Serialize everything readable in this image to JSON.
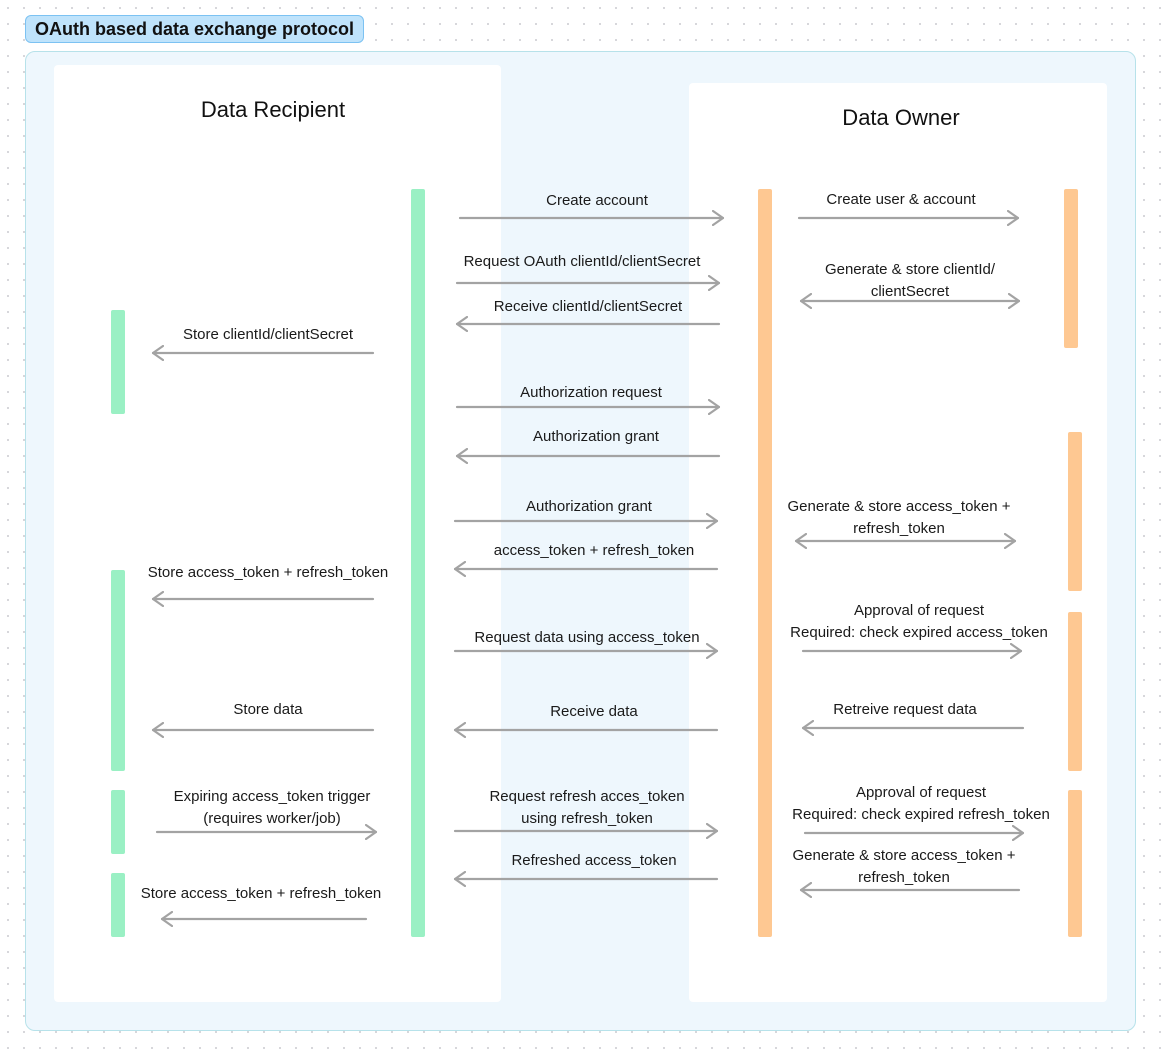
{
  "title": "OAuth based data exchange protocol",
  "lanes": {
    "recipient": "Data Recipient",
    "owner": "Data Owner"
  },
  "colors": {
    "recipient_activation": "#9af0c4",
    "owner_activation": "#fec892",
    "arrow": "#a3a3a3",
    "section_bg": "#eef7fd",
    "title_badge_bg": "#bfe3fb"
  },
  "messages": [
    {
      "id": "create-account",
      "label": "Create account",
      "direction": "right"
    },
    {
      "id": "create-user-account",
      "label": "Create user & account",
      "direction": "right"
    },
    {
      "id": "request-client-credentials",
      "label": "Request OAuth clientId/clientSecret",
      "direction": "right"
    },
    {
      "id": "generate-store-client-credentials",
      "label": "Generate & store clientId/\nclientSecret",
      "direction": "both"
    },
    {
      "id": "receive-client-credentials",
      "label": "Receive clientId/clientSecret",
      "direction": "left"
    },
    {
      "id": "store-client-credentials",
      "label": "Store clientId/clientSecret",
      "direction": "left"
    },
    {
      "id": "authorization-request",
      "label": "Authorization request",
      "direction": "right"
    },
    {
      "id": "authorization-grant-return",
      "label": "Authorization grant",
      "direction": "left"
    },
    {
      "id": "authorization-grant-send",
      "label": "Authorization grant",
      "direction": "right"
    },
    {
      "id": "generate-store-tokens",
      "label": "Generate & store access_token +\nrefresh_token",
      "direction": "both"
    },
    {
      "id": "tokens-return",
      "label": "access_token + refresh_token",
      "direction": "left"
    },
    {
      "id": "store-tokens-1",
      "label": "Store access_token + refresh_token",
      "direction": "left"
    },
    {
      "id": "request-data",
      "label": "Request data using access_token",
      "direction": "right"
    },
    {
      "id": "approval-access",
      "label": "Approval of request\nRequired: check expired access_token",
      "direction": "right"
    },
    {
      "id": "retrieve-data",
      "label": "Retreive request data",
      "direction": "left"
    },
    {
      "id": "receive-data",
      "label": "Receive data",
      "direction": "left"
    },
    {
      "id": "store-data",
      "label": "Store data",
      "direction": "left"
    },
    {
      "id": "expiring-trigger",
      "label": "Expiring access_token trigger\n(requires worker/job)",
      "direction": "right"
    },
    {
      "id": "request-refresh",
      "label": "Request refresh acces_token\nusing refresh_token",
      "direction": "right"
    },
    {
      "id": "approval-refresh",
      "label": "Approval of request\nRequired: check expired refresh_token",
      "direction": "right"
    },
    {
      "id": "generate-store-tokens-2",
      "label": "Generate & store access_token +\nrefresh_token",
      "direction": "left"
    },
    {
      "id": "refreshed-token",
      "label": "Refreshed access_token",
      "direction": "left"
    },
    {
      "id": "store-tokens-2",
      "label": "Store access_token + refresh_token",
      "direction": "left"
    }
  ]
}
